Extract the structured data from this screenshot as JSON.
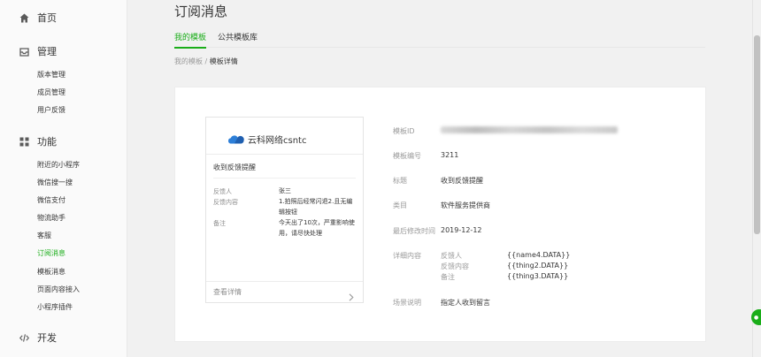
{
  "sidebar": {
    "sections": [
      {
        "label": "首页",
        "icon": "home-icon"
      },
      {
        "label": "管理",
        "icon": "inbox-icon"
      },
      {
        "label": "功能",
        "icon": "grid-icon"
      },
      {
        "label": "开发",
        "icon": "code-icon"
      }
    ],
    "manage_items": [
      "版本管理",
      "成员管理",
      "用户反馈"
    ],
    "feature_items": [
      "附近的小程序",
      "微信搜一搜",
      "微信支付",
      "物流助手",
      "客服",
      "订阅消息",
      "模板消息",
      "页面内容接入",
      "小程序插件"
    ],
    "active_item": "订阅消息"
  },
  "page": {
    "title": "订阅消息",
    "tabs": [
      "我的模板",
      "公共模板库"
    ],
    "active_tab": "我的模板",
    "breadcrumb": {
      "parent": "我的模板",
      "separator": "/",
      "current": "模板详情"
    }
  },
  "preview": {
    "brand": "云科网络csntc",
    "title": "收到反馈提醒",
    "fields": [
      {
        "key": "反馈人",
        "value": "张三"
      },
      {
        "key": "反馈内容",
        "value": "1.拍照后经常闪退2.且无编辑按钮"
      },
      {
        "key": "备注",
        "value": "今天出了10次，严重影响使用，请尽快处理"
      }
    ],
    "footer": "查看详情"
  },
  "details": {
    "template_id_label": "模板ID",
    "template_no_label": "模板编号",
    "template_no": "3211",
    "title_label": "标题",
    "title": "收到反馈提醒",
    "category_label": "类目",
    "category": "软件服务提供商",
    "modified_label": "最后修改时间",
    "modified": "2019-12-12",
    "content_label": "详细内容",
    "content": [
      {
        "key": "反馈人",
        "value": "{{name4.DATA}}"
      },
      {
        "key": "反馈内容",
        "value": "{{thing2.DATA}}"
      },
      {
        "key": "备注",
        "value": "{{thing3.DATA}}"
      }
    ],
    "scene_label": "场景说明",
    "scene": "指定人收到留言"
  },
  "colors": {
    "accent": "#1aad19",
    "brand_blue": "#2d7fd8"
  }
}
